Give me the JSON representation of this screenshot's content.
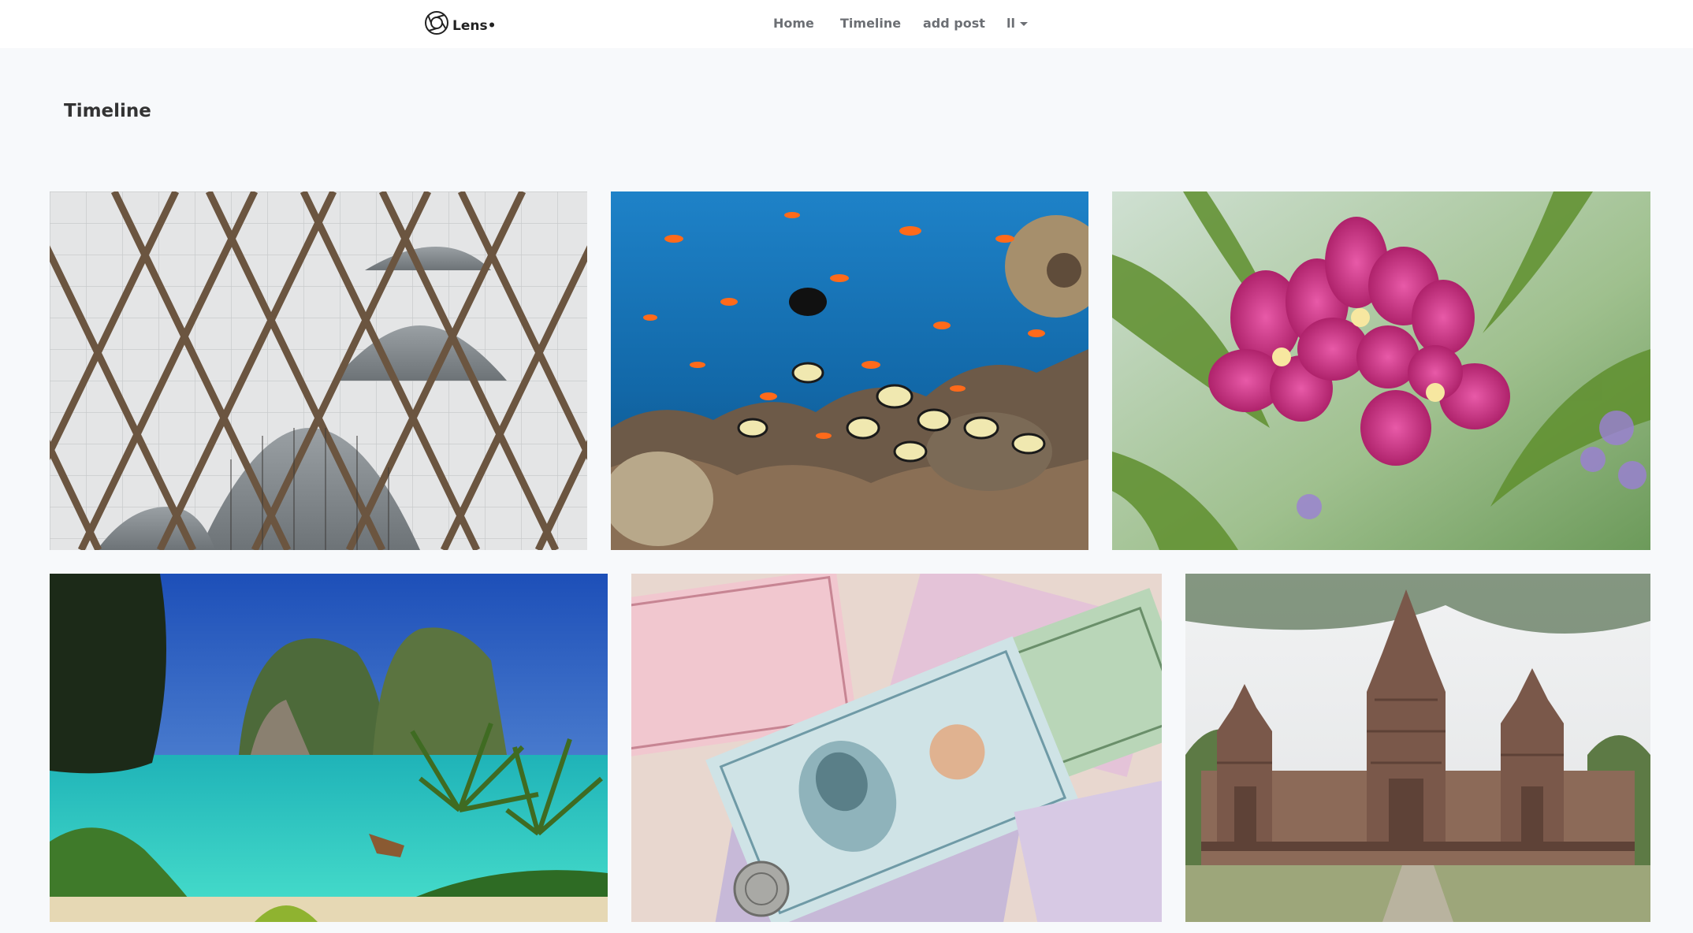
{
  "navbar": {
    "brand": "Lens•",
    "links": {
      "home": "Home",
      "timeline": "Timeline",
      "add_post": "add post"
    },
    "user": "ll"
  },
  "page": {
    "title": "Timeline"
  },
  "photos": [
    {
      "subject": "building-facade"
    },
    {
      "subject": "coral-reef-fish"
    },
    {
      "subject": "pink-orchid"
    },
    {
      "subject": "tropical-beach-bay"
    },
    {
      "subject": "thai-banknotes"
    },
    {
      "subject": "khmer-temple"
    }
  ]
}
